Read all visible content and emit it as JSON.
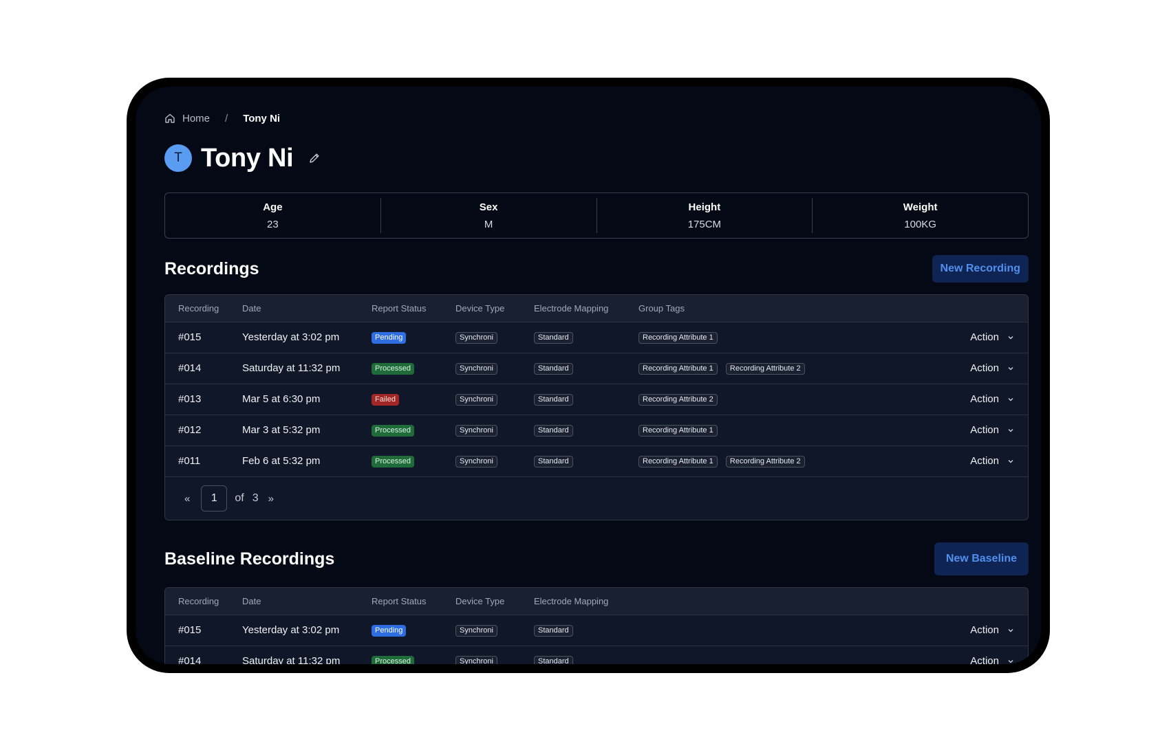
{
  "breadcrumb": {
    "home": "Home",
    "separator": "/",
    "current": "Tony Ni"
  },
  "patient": {
    "initial": "T",
    "name": "Tony Ni"
  },
  "stats": [
    {
      "label": "Age",
      "value": "23"
    },
    {
      "label": "Sex",
      "value": "M"
    },
    {
      "label": "Height",
      "value": "175CM"
    },
    {
      "label": "Weight",
      "value": "100KG"
    }
  ],
  "recordings": {
    "title": "Recordings",
    "new_button": "New Recording",
    "columns": [
      "Recording",
      "Date",
      "Report Status",
      "Device Type",
      "Electrode Mapping",
      "Group Tags"
    ],
    "rows": [
      {
        "id": "#015",
        "date": "Yesterday at 3:02 pm",
        "status": "Pending",
        "device": "Synchroni",
        "mapping": "Standard",
        "tags": [
          "Recording Attribute 1"
        ],
        "action": "Action"
      },
      {
        "id": "#014",
        "date": "Saturday at 11:32 pm",
        "status": "Processed",
        "device": "Synchroni",
        "mapping": "Standard",
        "tags": [
          "Recording Attribute 1",
          "Recording Attribute 2"
        ],
        "action": "Action"
      },
      {
        "id": "#013",
        "date": "Mar 5 at 6:30 pm",
        "status": "Failed",
        "device": "Synchroni",
        "mapping": "Standard",
        "tags": [
          "Recording Attribute 2"
        ],
        "action": "Action"
      },
      {
        "id": "#012",
        "date": "Mar 3 at 5:32 pm",
        "status": "Processed",
        "device": "Synchroni",
        "mapping": "Standard",
        "tags": [
          "Recording Attribute 1"
        ],
        "action": "Action"
      },
      {
        "id": "#011",
        "date": "Feb 6 at 5:32 pm",
        "status": "Processed",
        "device": "Synchroni",
        "mapping": "Standard",
        "tags": [
          "Recording Attribute 1",
          "Recording Attribute 2"
        ],
        "action": "Action"
      }
    ],
    "pagination": {
      "prev": "«",
      "page": "1",
      "of": "of",
      "total": "3",
      "next": "»"
    }
  },
  "baseline": {
    "title": "Baseline Recordings",
    "new_button": "New Baseline",
    "columns": [
      "Recording",
      "Date",
      "Report Status",
      "Device Type",
      "Electrode Mapping"
    ],
    "rows": [
      {
        "id": "#015",
        "date": "Yesterday at 3:02 pm",
        "status": "Pending",
        "device": "Synchroni",
        "mapping": "Standard",
        "action": "Action"
      },
      {
        "id": "#014",
        "date": "Saturday at 11:32 pm",
        "status": "Processed",
        "device": "Synchroni",
        "mapping": "Standard",
        "action": "Action"
      }
    ]
  },
  "colors": {
    "accent": "#4f8ff0",
    "pending": "#2f6ee0",
    "processed": "#1f6b3a",
    "failed": "#a32626",
    "avatar": "#5a9cf2"
  },
  "icons": {
    "home": "home-icon",
    "edit": "pencil-icon",
    "dropdown": "chevron-down-icon"
  }
}
